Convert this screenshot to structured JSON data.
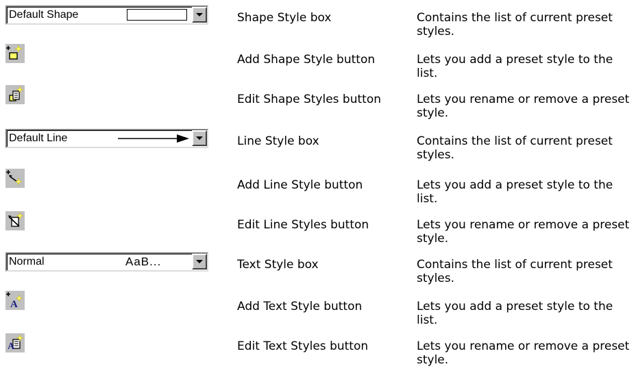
{
  "rows": [
    {
      "control": {
        "type": "combo",
        "value": "Default Shape",
        "icon": "shape-swatch"
      },
      "name": "Shape Style box",
      "desc": "Contains the list of current preset styles."
    },
    {
      "control": {
        "type": "icon",
        "icon": "add-shape-style-icon"
      },
      "name": "Add Shape Style button",
      "desc": "Lets you add a preset style to the list."
    },
    {
      "control": {
        "type": "icon",
        "icon": "edit-shape-styles-icon"
      },
      "name": "Edit Shape Styles button",
      "desc": "Lets you rename or remove a preset style."
    },
    {
      "control": {
        "type": "combo",
        "value": "Default Line",
        "icon": "line-arrow"
      },
      "name": "Line Style box",
      "desc": "Contains the list of current preset styles."
    },
    {
      "control": {
        "type": "icon",
        "icon": "add-line-style-icon"
      },
      "name": "Add Line Style button",
      "desc": "Lets you add a preset style to the list."
    },
    {
      "control": {
        "type": "icon",
        "icon": "edit-line-styles-icon"
      },
      "name": "Edit Line Styles button",
      "desc": "Lets you rename or remove a preset style."
    },
    {
      "control": {
        "type": "combo",
        "value": "Normal",
        "sample": "AaB...",
        "icon": "text-sample"
      },
      "name": "Text Style box",
      "desc": "Contains the list of current preset styles."
    },
    {
      "control": {
        "type": "icon",
        "icon": "add-text-style-icon"
      },
      "name": "Add Text Style button",
      "desc": "Lets you add a preset style to the list."
    },
    {
      "control": {
        "type": "icon",
        "icon": "edit-text-styles-icon"
      },
      "name": "Edit Text Styles button",
      "desc": "Lets you rename or remove a preset style."
    }
  ]
}
